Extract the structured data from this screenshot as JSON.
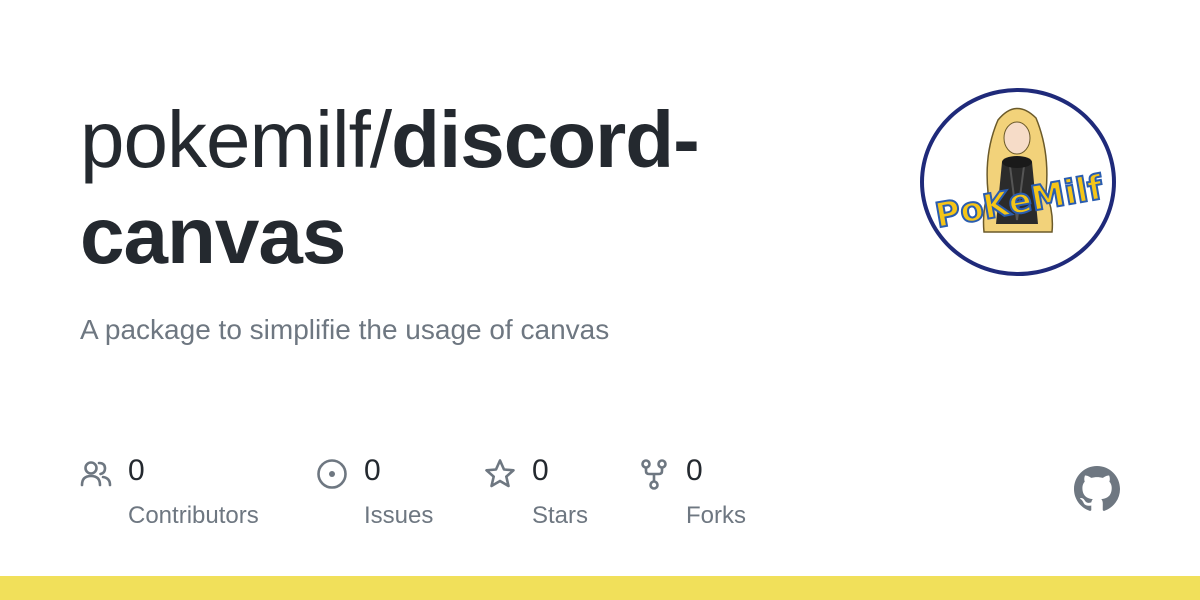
{
  "repo": {
    "owner": "pokemilf/",
    "name": "discord-canvas",
    "description": "A package to simplifie the usage of canvas"
  },
  "avatar": {
    "logo_text": "PoKeMilf"
  },
  "stats": [
    {
      "icon": "people-icon",
      "value": "0",
      "label": "Contributors"
    },
    {
      "icon": "issue-icon",
      "value": "0",
      "label": "Issues"
    },
    {
      "icon": "star-icon",
      "value": "0",
      "label": "Stars"
    },
    {
      "icon": "fork-icon",
      "value": "0",
      "label": "Forks"
    }
  ],
  "colors": {
    "text": "#24292f",
    "muted": "#6e7781",
    "accent_bar": "#f1e05a",
    "avatar_border": "#1f2a7a",
    "logo_yellow": "#f5c518",
    "logo_blue": "#2a5db0"
  }
}
